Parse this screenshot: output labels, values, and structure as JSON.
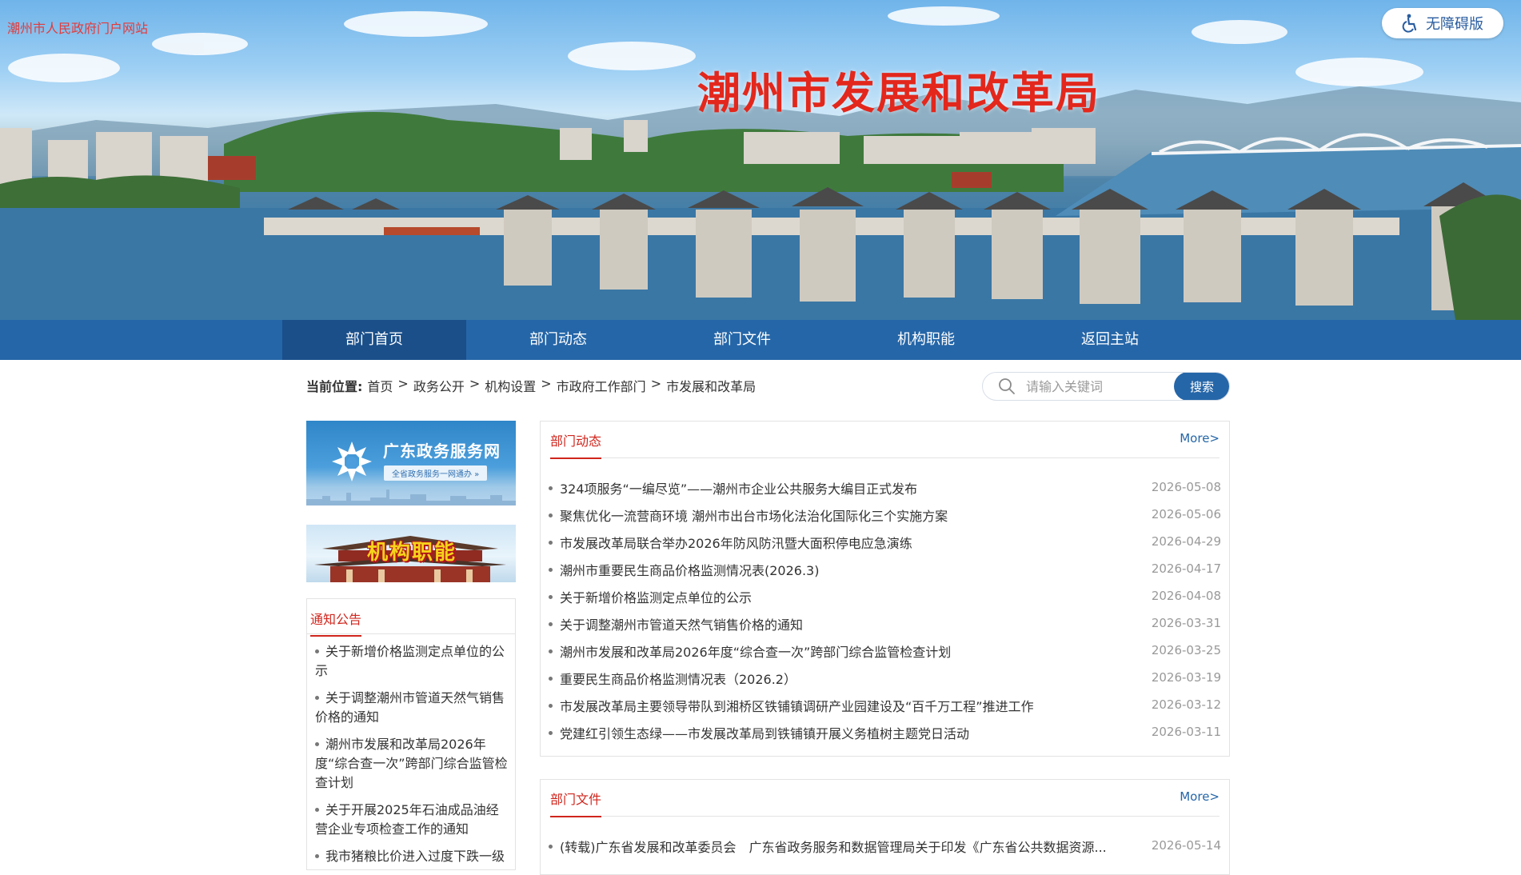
{
  "header": {
    "portal_link": "潮州市人民政府门户网站",
    "accessibility_label": "无障碍版",
    "site_title": "潮州市发展和改革局"
  },
  "nav": {
    "items": [
      "部门首页",
      "部门动态",
      "部门文件",
      "机构职能",
      "返回主站"
    ],
    "active_index": 0
  },
  "breadcrumb": {
    "label": "当前位置:",
    "items": [
      "首页",
      "政务公开",
      "机构设置",
      "市政府工作部门",
      "市发展和改革局"
    ],
    "separator": ">"
  },
  "search": {
    "placeholder": "请输入关键词",
    "button_label": "搜索"
  },
  "left": {
    "service_banner": {
      "title": "广东政务服务网",
      "subtitle": "全省政务服务一网通办 »"
    },
    "function_banner": {
      "title": "机构职能"
    },
    "notice": {
      "title": "通知公告",
      "items": [
        "关于新增价格监测定点单位的公示",
        "关于调整潮州市管道天然气销售价格的通知",
        "潮州市发展和改革局2026年度“综合查一次”跨部门综合监管检查计划",
        "关于开展2025年石油成品油经营企业专项检查工作的通知",
        "我市猪粮比价进入过度下跌一级"
      ]
    }
  },
  "news": {
    "title": "部门动态",
    "more": "More>",
    "items": [
      {
        "title": "324项服务“一编尽览”——潮州市企业公共服务大编目正式发布",
        "date": "2026-05-08"
      },
      {
        "title": "聚焦优化一流营商环境 潮州市出台市场化法治化国际化三个实施方案",
        "date": "2026-05-06"
      },
      {
        "title": "市发展改革局联合举办2026年防风防汛暨大面积停电应急演练",
        "date": "2026-04-29"
      },
      {
        "title": "潮州市重要民生商品价格监测情况表(2026.3)",
        "date": "2026-04-17"
      },
      {
        "title": "关于新增价格监测定点单位的公示",
        "date": "2026-04-08"
      },
      {
        "title": "关于调整潮州市管道天然气销售价格的通知",
        "date": "2026-03-31"
      },
      {
        "title": "潮州市发展和改革局2026年度“综合查一次”跨部门综合监管检查计划",
        "date": "2026-03-25"
      },
      {
        "title": "重要民生商品价格监测情况表（2026.2）",
        "date": "2026-03-19"
      },
      {
        "title": "市发展改革局主要领导带队到湘桥区铁铺镇调研产业园建设及“百千万工程”推进工作",
        "date": "2026-03-12"
      },
      {
        "title": "党建红引领生态绿——市发展改革局到铁铺镇开展义务植树主题党日活动",
        "date": "2026-03-11"
      }
    ]
  },
  "docs": {
    "title": "部门文件",
    "more": "More>",
    "items": [
      {
        "title": "(转载)广东省发展和改革委员会　广东省政务服务和数据管理局关于印发《广东省公共数据资源...",
        "date": "2026-05-14"
      }
    ]
  },
  "colors": {
    "nav_bg": "#2566a8",
    "nav_active": "#1a4f8a",
    "accent_red": "#d0261d",
    "title_red": "#e3271c"
  }
}
